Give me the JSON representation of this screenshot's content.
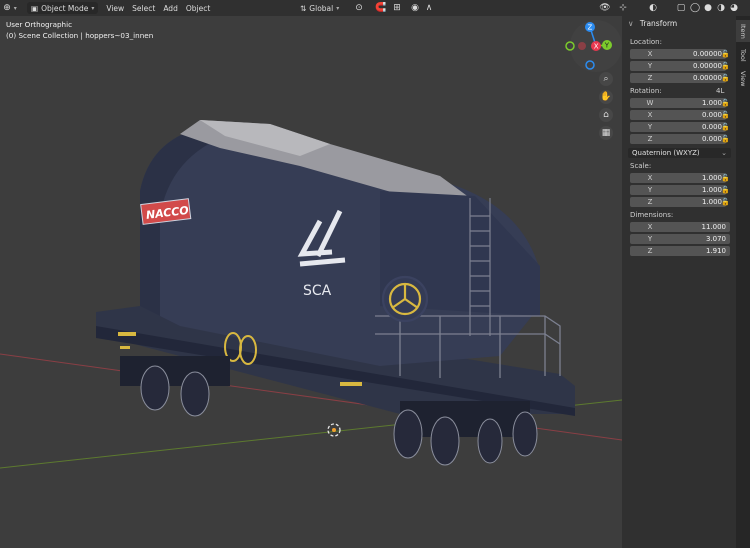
{
  "header": {
    "mode": "Object Mode",
    "menus": [
      "View",
      "Select",
      "Add",
      "Object"
    ],
    "orientation": "Global"
  },
  "viewport": {
    "view_name": "User Orthographic",
    "collection_path": "(0) Scene Collection | hoppers~03_innen",
    "gizmo_axes": [
      "Z",
      "X",
      "Y"
    ],
    "wagon_logo": "NACCO",
    "wagon_mark": "SCA"
  },
  "panel": {
    "title": "Transform",
    "tabs": [
      "Item",
      "Tool",
      "View"
    ],
    "location": {
      "label": "Location:",
      "rows": [
        {
          "axis": "X",
          "value": "0.00000"
        },
        {
          "axis": "Y",
          "value": "0.00000"
        },
        {
          "axis": "Z",
          "value": "0.00000"
        }
      ]
    },
    "rotation": {
      "label": "Rotation:",
      "lock_label": "4L",
      "rows": [
        {
          "axis": "W",
          "value": "1.000"
        },
        {
          "axis": "X",
          "value": "0.000"
        },
        {
          "axis": "Y",
          "value": "0.000"
        },
        {
          "axis": "Z",
          "value": "0.000"
        }
      ],
      "mode": "Quaternion (WXYZ)"
    },
    "scale": {
      "label": "Scale:",
      "rows": [
        {
          "axis": "X",
          "value": "1.000"
        },
        {
          "axis": "Y",
          "value": "1.000"
        },
        {
          "axis": "Z",
          "value": "1.000"
        }
      ]
    },
    "dimensions": {
      "label": "Dimensions:",
      "rows": [
        {
          "axis": "X",
          "value": "11.000"
        },
        {
          "axis": "Y",
          "value": "3.070"
        },
        {
          "axis": "Z",
          "value": "1.910"
        }
      ]
    }
  },
  "colors": {
    "x_axis": "#e8384f",
    "y_axis": "#7ccc2c",
    "z_axis": "#2c8cf0",
    "wagon_body": "#363d55"
  }
}
